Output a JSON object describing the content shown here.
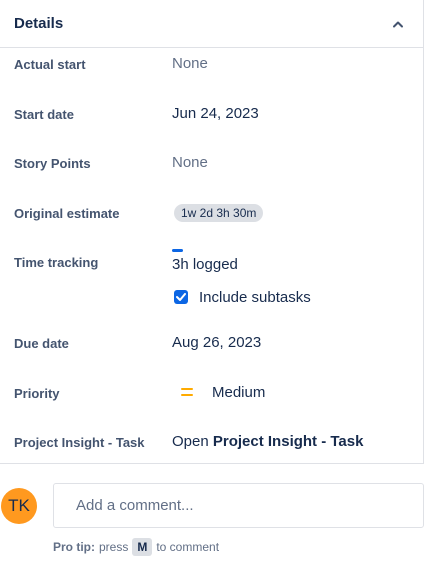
{
  "details": {
    "title": "Details"
  },
  "fields": {
    "actual_start": {
      "label": "Actual start",
      "value": "None"
    },
    "start_date": {
      "label": "Start date",
      "value": "Jun 24, 2023"
    },
    "story_points": {
      "label": "Story Points",
      "value": "None"
    },
    "original_estimate": {
      "label": "Original estimate",
      "value": "1w 2d 3h 30m"
    },
    "time_tracking": {
      "label": "Time tracking",
      "logged": "3h logged",
      "include_subtasks_label": "Include subtasks",
      "include_subtasks_checked": true
    },
    "due_date": {
      "label": "Due date",
      "value": "Aug 26, 2023"
    },
    "priority": {
      "label": "Priority",
      "value": "Medium",
      "icon": "priority-medium-icon",
      "color": "#ffab00"
    },
    "project_insight_task": {
      "label": "Project Insight - Task",
      "prefix": "Open",
      "link": "Project Insight - Task"
    }
  },
  "comment": {
    "avatar_initials": "TK",
    "avatar_color": "#ff991f",
    "placeholder": "Add a comment...",
    "tip_bold": "Pro tip:",
    "tip_press": "press",
    "tip_key": "M",
    "tip_suffix": "to comment"
  },
  "colors": {
    "accent": "#0c66e4"
  }
}
